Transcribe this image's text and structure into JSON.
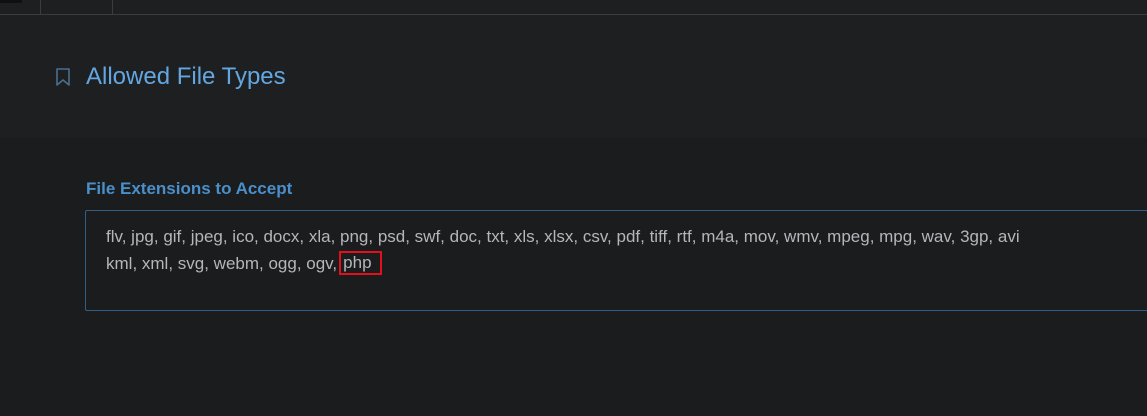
{
  "header": {
    "title": "Allowed File Types",
    "icon": "bookmark-icon"
  },
  "form": {
    "field_label": "File Extensions to Accept",
    "extensions_line1": "flv, jpg, gif, jpeg, ico, docx, xla, png, psd, swf, doc, txt, xls, xlsx, csv, pdf, tiff, rtf, m4a, mov, wmv, mpeg, mpg, wav, 3gp, avi",
    "extensions_line2_prefix": "kml, xml, svg, webm, ogg, ogv,",
    "extensions_highlighted": "php"
  },
  "colors": {
    "title": "#63a7e2",
    "label": "#4a8fca",
    "text": "#b3b6ba",
    "textarea_border": "#2f5f86",
    "highlight_border": "#e3101c",
    "background": "#1b1c1e"
  }
}
